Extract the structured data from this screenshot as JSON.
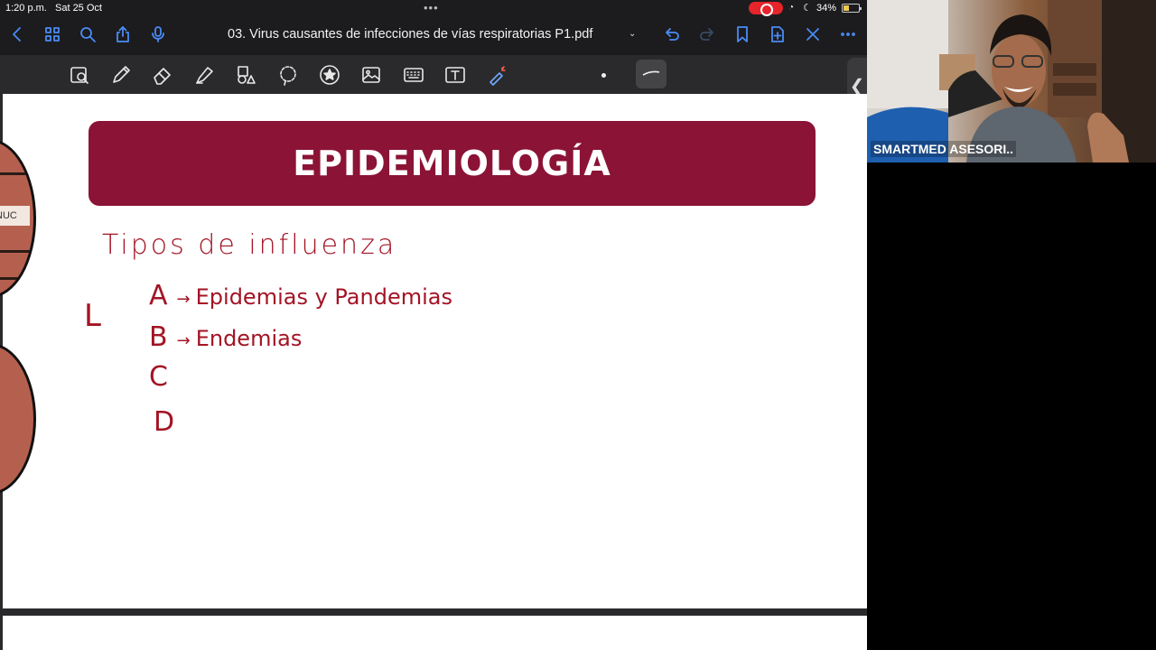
{
  "status_bar": {
    "time": "1:20 p.m.",
    "date": "Sat 25 Oct",
    "battery": "34%"
  },
  "nav_bar": {
    "title": "03. Virus causantes de infecciones de vías respiratorias P1.pdf",
    "accent_color": "#4a8bf5"
  },
  "toolbar": {
    "tools": [
      "zoom-select-icon",
      "pen-icon",
      "eraser-icon",
      "highlighter-icon",
      "shapes-icon",
      "lasso-icon",
      "sticker-icon",
      "image-icon",
      "keyboard-icon",
      "text-box-icon",
      "laser-pointer-icon"
    ]
  },
  "document": {
    "banner_title": "EPIDEMIOLOGÍA",
    "banner_color": "#8b1336",
    "ink_color": "#a31425",
    "decor_label": "NUC",
    "handwriting": {
      "title": "Tipos de influenza",
      "bracket": "L",
      "rows": [
        {
          "letter": "A",
          "text": "Epidemias y Pandemias"
        },
        {
          "letter": "B",
          "text": "Endemias"
        },
        {
          "letter": "C",
          "text": ""
        },
        {
          "letter": "D",
          "text": ""
        }
      ]
    }
  },
  "webcam": {
    "participant_name": "SMARTMED ASESORI.."
  }
}
